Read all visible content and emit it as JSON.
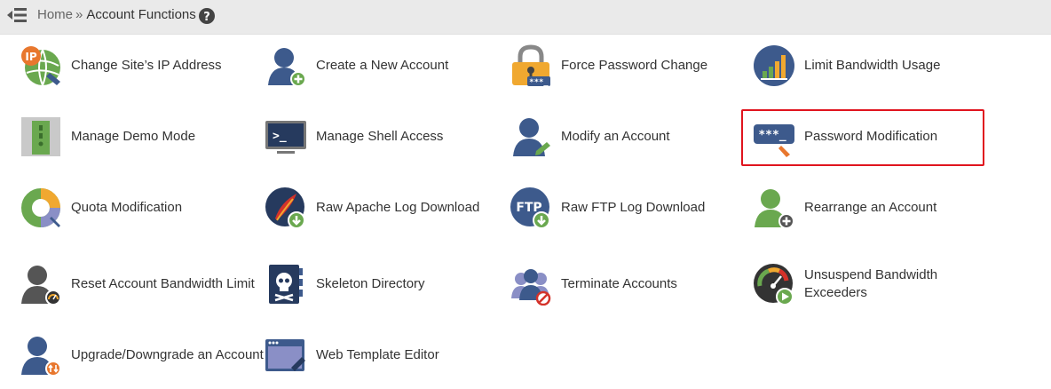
{
  "breadcrumb": {
    "home": "Home",
    "separator": "»",
    "current": "Account Functions"
  },
  "functions": [
    {
      "label": "Change Site’s IP Address",
      "icon": "ip-address-icon"
    },
    {
      "label": "Create a New Account",
      "icon": "create-account-icon"
    },
    {
      "label": "Force Password Change",
      "icon": "lock-icon"
    },
    {
      "label": "Limit Bandwidth Usage",
      "icon": "bandwidth-chart-icon"
    },
    {
      "label": "Manage Demo Mode",
      "icon": "demo-mode-icon"
    },
    {
      "label": "Manage Shell Access",
      "icon": "terminal-icon"
    },
    {
      "label": "Modify an Account",
      "icon": "modify-account-icon"
    },
    {
      "label": "Password Modification",
      "icon": "password-field-icon"
    },
    {
      "label": "Quota Modification",
      "icon": "quota-donut-icon"
    },
    {
      "label": "Raw Apache Log Download",
      "icon": "apache-feather-download-icon"
    },
    {
      "label": "Raw FTP Log Download",
      "icon": "ftp-download-icon"
    },
    {
      "label": "Rearrange an Account",
      "icon": "rearrange-account-icon"
    },
    {
      "label": "Reset Account Bandwidth Limit",
      "icon": "reset-bandwidth-icon"
    },
    {
      "label": "Skeleton Directory",
      "icon": "skull-folder-icon"
    },
    {
      "label": "Terminate Accounts",
      "icon": "terminate-accounts-icon"
    },
    {
      "label": "Unsuspend Bandwidth Exceeders",
      "icon": "gauge-play-icon"
    },
    {
      "label": "Upgrade/Downgrade an Account",
      "icon": "upgrade-account-icon"
    },
    {
      "label": "Web Template Editor",
      "icon": "web-template-icon"
    }
  ],
  "highlighted_item": "Password Modification",
  "colors": {
    "topbar": "#eaeaea",
    "highlight_border": "#e0141e",
    "icon_blue": "#3d5a8c",
    "icon_green": "#6aa84f",
    "icon_orange": "#e8772e"
  }
}
